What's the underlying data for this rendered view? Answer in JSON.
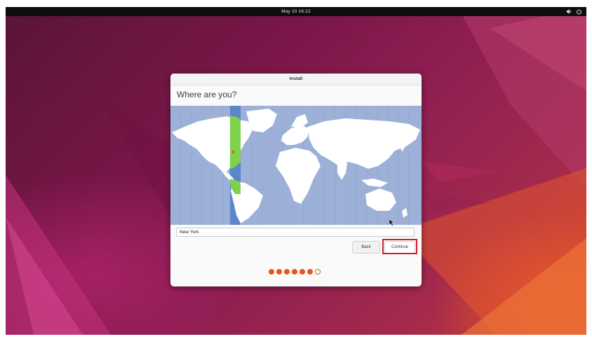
{
  "topbar": {
    "clock": "May 10  16:22",
    "icons": [
      "volume-icon",
      "power-icon"
    ]
  },
  "installer": {
    "window_title": "Install",
    "heading": "Where are you?",
    "timezone_value": "New York",
    "buttons": {
      "back": "Back",
      "continue": "Continue"
    },
    "progress": {
      "total_steps": 7,
      "completed_steps": 6
    }
  },
  "colors": {
    "accent": "#e95420",
    "map_ocean": "#9cb0d8",
    "timezone_highlight": "#5b87c9",
    "selected_region": "#7ed24a",
    "highlight_box": "#d31f2a"
  }
}
